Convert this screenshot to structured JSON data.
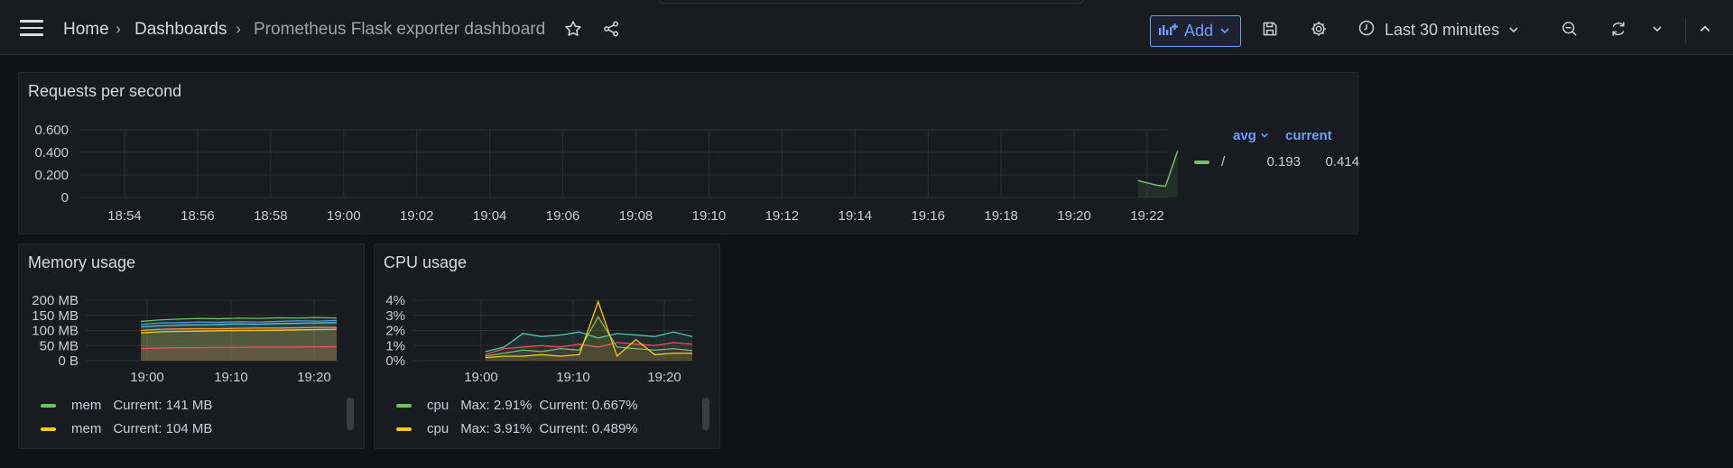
{
  "breadcrumb": {
    "home": "Home",
    "dashboards": "Dashboards",
    "current": "Prometheus Flask exporter dashboard",
    "separator": "›"
  },
  "toolbar": {
    "add_label": "Add",
    "time_range": "Last 30 minutes",
    "icons": [
      "menu-icon",
      "star-icon",
      "share-icon",
      "add-panel-icon",
      "chevron-down-icon",
      "save-icon",
      "gear-icon",
      "clock-icon",
      "zoom-out-icon",
      "refresh-icon",
      "chevron-up-icon"
    ]
  },
  "colors": {
    "accent": "#6e9fff",
    "green": "#73bf69",
    "yellow": "#f2cc0c",
    "blue": "#5794f2",
    "red": "#f2495c",
    "orange": "#ff9830",
    "teal": "#56c9b9"
  },
  "panels": {
    "requests": {
      "title": "Requests per second",
      "legend": {
        "avg_header": "avg",
        "current_header": "current",
        "rows": [
          {
            "name": "/",
            "avg": "0.193",
            "current": "0.414",
            "color": "#73bf69"
          }
        ]
      }
    },
    "memory": {
      "title": "Memory usage",
      "legend": [
        {
          "name": "mem",
          "value": "Current: 141 MB",
          "color": "#73bf69"
        },
        {
          "name": "mem",
          "value": "Current: 104 MB",
          "color": "#f2cc0c"
        }
      ]
    },
    "cpu": {
      "title": "CPU usage",
      "legend": [
        {
          "name": "cpu",
          "max": "Max: 2.91%",
          "value": "Current: 0.667%",
          "color": "#73bf69"
        },
        {
          "name": "cpu",
          "max": "Max: 3.91%",
          "value": "Current: 0.489%",
          "color": "#f2cc0c"
        }
      ]
    }
  },
  "chart_data": [
    {
      "type": "line",
      "title": "Requests per second",
      "x_ticks": [
        "18:54",
        "18:56",
        "18:58",
        "19:00",
        "19:02",
        "19:04",
        "19:06",
        "19:08",
        "19:10",
        "19:12",
        "19:14",
        "19:16",
        "19:18",
        "19:20",
        "19:22"
      ],
      "y_ticks": [
        "0",
        "0.200",
        "0.400",
        "0.600"
      ],
      "ylim": [
        0,
        0.6
      ],
      "series": [
        {
          "name": "/",
          "x": [
            "19:21:45",
            "19:22:15",
            "19:22:30",
            "19:22:50"
          ],
          "values": [
            0.15,
            0.11,
            0.1,
            0.414
          ]
        }
      ]
    },
    {
      "type": "area",
      "title": "Memory usage",
      "x_ticks": [
        "19:00",
        "19:10",
        "19:20"
      ],
      "y_ticks": [
        "0 B",
        "50 MB",
        "100 MB",
        "150 MB",
        "200 MB"
      ],
      "ylim": [
        0,
        200
      ],
      "series": [
        {
          "name": "mem",
          "color": "#73bf69",
          "values": [
            130,
            135,
            138,
            140,
            139,
            141,
            140,
            142,
            141,
            143,
            141
          ]
        },
        {
          "name": "mem",
          "color": "#5794f2",
          "values": [
            120,
            125,
            126,
            128,
            127,
            129,
            128,
            130,
            132,
            131,
            133
          ]
        },
        {
          "name": "mem",
          "color": "#56c9b9",
          "values": [
            112,
            116,
            118,
            119,
            120,
            122,
            121,
            123,
            124,
            125,
            126
          ]
        },
        {
          "name": "mem",
          "color": "#ff9830",
          "values": [
            100,
            104,
            105,
            106,
            106,
            107,
            108,
            108,
            109,
            110,
            110
          ]
        },
        {
          "name": "mem",
          "color": "#f2cc0c",
          "values": [
            92,
            96,
            97,
            98,
            99,
            100,
            100,
            101,
            102,
            103,
            104
          ]
        },
        {
          "name": "mem",
          "color": "#f2495c",
          "values": [
            40,
            42,
            43,
            43,
            44,
            44,
            45,
            45,
            45,
            46,
            46
          ]
        }
      ]
    },
    {
      "type": "area",
      "title": "CPU usage",
      "x_ticks": [
        "19:00",
        "19:10",
        "19:20"
      ],
      "y_ticks": [
        "0%",
        "1%",
        "2%",
        "3%",
        "4%"
      ],
      "ylim": [
        0,
        4
      ],
      "series": [
        {
          "name": "cpu",
          "color": "#56c9b9",
          "values": [
            0.6,
            0.9,
            1.8,
            1.6,
            1.7,
            1.9,
            1.5,
            1.8,
            1.7,
            1.6,
            1.9,
            1.6
          ]
        },
        {
          "name": "cpu",
          "color": "#f2495c",
          "values": [
            0.4,
            0.8,
            0.9,
            1.0,
            0.9,
            1.1,
            0.9,
            1.2,
            1.1,
            1.0,
            1.2,
            1.1
          ]
        },
        {
          "name": "cpu",
          "color": "#73bf69",
          "values": [
            0.3,
            0.5,
            0.7,
            0.6,
            0.8,
            0.7,
            2.91,
            0.9,
            0.8,
            0.7,
            0.8,
            0.667
          ]
        },
        {
          "name": "cpu",
          "color": "#f2cc0c",
          "values": [
            0.2,
            0.3,
            0.3,
            0.4,
            0.3,
            0.4,
            3.91,
            0.3,
            1.4,
            0.4,
            0.5,
            0.489
          ]
        }
      ]
    }
  ]
}
